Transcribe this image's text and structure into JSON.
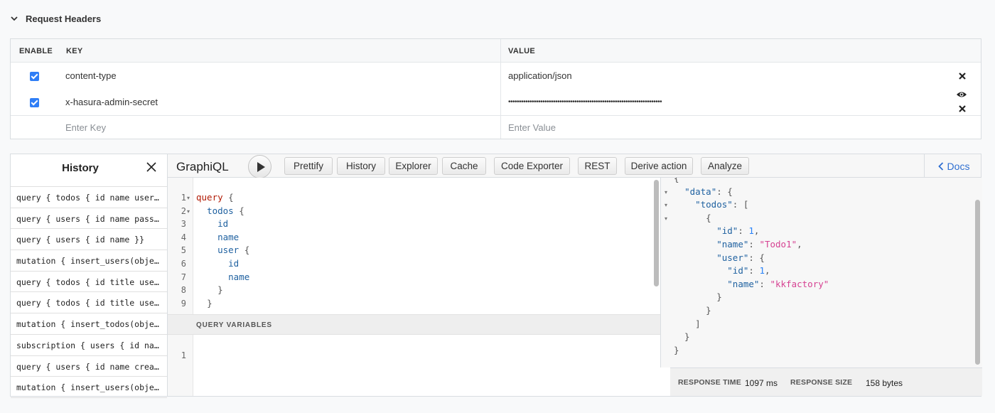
{
  "request_headers": {
    "title": "Request Headers",
    "columns": {
      "enable": "ENABLE",
      "key": "KEY",
      "value": "VALUE"
    },
    "rows": [
      {
        "enabled": true,
        "key": "content-type",
        "value": "application/json"
      },
      {
        "enabled": true,
        "key": "x-hasura-admin-secret",
        "value": "••••••••••••••••••••••••••••••••••••••••••••••••••••••••••••••••••••••••"
      }
    ],
    "new_row": {
      "key_placeholder": "Enter Key",
      "value_placeholder": "Enter Value"
    }
  },
  "history": {
    "title": "History",
    "items": [
      "query { todos { id name user { id name } } }",
      "query { users { id name password } }",
      "query { users { id name }}",
      "mutation { insert_users(objects: {}) }",
      "query { todos { id title user { id } } }",
      "query { todos { id title user { name } } }",
      "mutation { insert_todos(objects: {}) }",
      "subscription { users { id name } }",
      "query { users { id name created_at } }",
      "mutation { insert_users(objects: {}) }"
    ]
  },
  "toolbar": {
    "title": "GraphiQL",
    "buttons": [
      "Prettify",
      "History",
      "Explorer",
      "Cache",
      "Code Exporter",
      "REST",
      "Derive action",
      "Analyze"
    ],
    "docs": "Docs"
  },
  "query_editor": {
    "lines": [
      {
        "n": "1",
        "fold": "▾",
        "text": "query {"
      },
      {
        "n": "2",
        "fold": "▾",
        "text": "  todos {"
      },
      {
        "n": "3",
        "fold": "",
        "text": "    id"
      },
      {
        "n": "4",
        "fold": "",
        "text": "    name"
      },
      {
        "n": "5",
        "fold": "",
        "text": "    user {"
      },
      {
        "n": "6",
        "fold": "",
        "text": "      id"
      },
      {
        "n": "7",
        "fold": "",
        "text": "      name"
      },
      {
        "n": "8",
        "fold": "",
        "text": "    }"
      },
      {
        "n": "9",
        "fold": "",
        "text": "  }"
      }
    ]
  },
  "query_variables": {
    "label": "QUERY VARIABLES",
    "line_number": "1"
  },
  "result": {
    "lines": [
      "{",
      "  \"data\": {",
      "    \"todos\": [",
      "      {",
      "        \"id\": 1,",
      "        \"name\": \"Todo1\",",
      "        \"user\": {",
      "          \"id\": 1,",
      "          \"name\": \"kkfactory\"",
      "        }",
      "      }",
      "    ]",
      "  }",
      "}"
    ],
    "response_time_label": "RESPONSE TIME",
    "response_time": "1097 ms",
    "response_size_label": "RESPONSE SIZE",
    "response_size": "158 bytes"
  }
}
